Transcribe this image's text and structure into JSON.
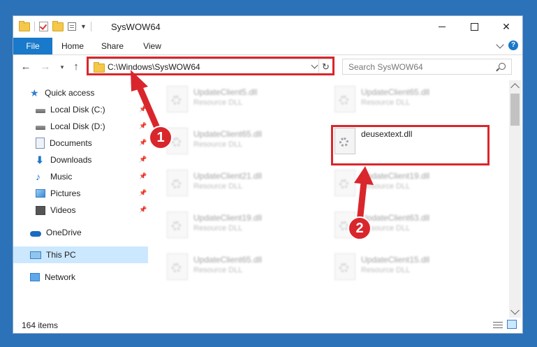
{
  "window": {
    "title": "SysWOW64",
    "controls": [
      "minimize",
      "maximize",
      "close"
    ]
  },
  "ribbon": {
    "tabs": [
      {
        "label": "File",
        "active": true
      },
      {
        "label": "Home"
      },
      {
        "label": "Share"
      },
      {
        "label": "View"
      }
    ],
    "help_label": "?"
  },
  "navigation": {
    "address_path": "C:\\Windows\\SysWOW64",
    "search_placeholder": "Search SysWOW64"
  },
  "sidebar": {
    "items": [
      {
        "label": "Quick access",
        "icon": "star-icon"
      },
      {
        "label": "Local Disk (C:)",
        "icon": "drive-icon",
        "pinned": true
      },
      {
        "label": "Local Disk (D:)",
        "icon": "drive-icon",
        "pinned": true
      },
      {
        "label": "Documents",
        "icon": "documents-icon",
        "pinned": true
      },
      {
        "label": "Downloads",
        "icon": "download-icon",
        "pinned": true
      },
      {
        "label": "Music",
        "icon": "music-icon",
        "pinned": true
      },
      {
        "label": "Pictures",
        "icon": "pictures-icon",
        "pinned": true
      },
      {
        "label": "Videos",
        "icon": "videos-icon",
        "pinned": true
      },
      {
        "label": "OneDrive",
        "icon": "cloud-icon"
      },
      {
        "label": "This PC",
        "icon": "computer-icon",
        "selected": true
      },
      {
        "label": "Network",
        "icon": "network-icon"
      }
    ]
  },
  "files": [
    {
      "name": "UpdateClient5.dll",
      "type": "Resource DLL",
      "blurred": true
    },
    {
      "name": "UpdateClient65.dll",
      "type": "Resource DLL",
      "blurred": true
    },
    {
      "name": "UpdateClient65.dll",
      "type": "Resource DLL",
      "blurred": true
    },
    {
      "name": "deusextext.dll",
      "type": "",
      "blurred": false,
      "highlighted": true
    },
    {
      "name": "UpdateClient21.dll",
      "type": "Resource DLL",
      "blurred": true
    },
    {
      "name": "UpdateClient19.dll",
      "type": "Resource DLL",
      "blurred": true
    },
    {
      "name": "UpdateClient19.dll",
      "type": "Resource DLL",
      "blurred": true
    },
    {
      "name": "UpdateClient63.dll",
      "type": "Resource DLL",
      "blurred": true
    },
    {
      "name": "UpdateClient65.dll",
      "type": "Resource DLL",
      "blurred": true
    },
    {
      "name": "UpdateClient15.dll",
      "type": "Resource DLL",
      "blurred": true
    }
  ],
  "status": {
    "item_count": "164 items"
  },
  "annotations": {
    "step1": "1",
    "step2": "2",
    "color": "#d9262c"
  },
  "colors": {
    "accent": "#1979ca",
    "selection": "#cce8ff",
    "desktop": "#2b72b8"
  }
}
